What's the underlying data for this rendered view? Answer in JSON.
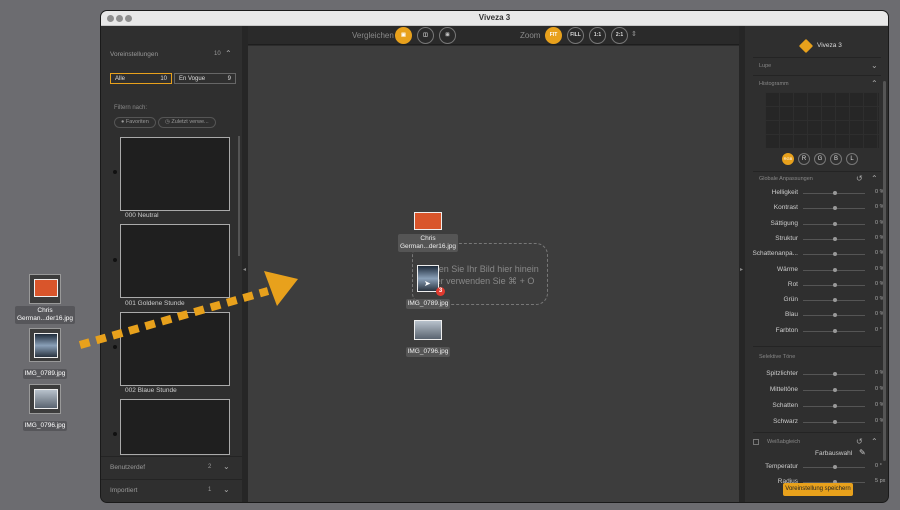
{
  "desktop": {
    "files": [
      {
        "label_line1": "Chris",
        "label_line2": "German...der16.jpg"
      },
      {
        "label_line1": "IMG_0789.jpg"
      },
      {
        "label_line1": "IMG_0796.jpg"
      }
    ]
  },
  "window": {
    "title": "Viveza 3"
  },
  "toolbar": {
    "compare_label": "Vergleichen",
    "zoom_label": "Zoom",
    "zoom_buttons": [
      "FIT",
      "FILL",
      "1:1",
      "2:1"
    ]
  },
  "left_panel": {
    "presets_title": "Voreinstellungen",
    "presets_count": "10",
    "tabs": [
      {
        "label": "Alle",
        "count": "10"
      },
      {
        "label": "En Vogue",
        "count": "9"
      }
    ],
    "filter_label": "Filtern nach:",
    "filters": [
      "Favoriten",
      "Zuletzt verwe..."
    ],
    "presets": [
      "000 Neutral",
      "001 Goldene Stunde",
      "002 Blaue Stunde"
    ],
    "sections": [
      {
        "label": "Benutzerdef",
        "count": "2"
      },
      {
        "label": "Importiert",
        "count": "1"
      }
    ]
  },
  "center": {
    "dropzone_text": "Ziehen Sie Ihr Bild hier hinein oder verwenden Sie ⌘ + O",
    "dragged": [
      {
        "label_line1": "Chris",
        "label_line2": "German...der16.jpg"
      },
      {
        "label_line1": "IMG_0789.jpg",
        "badge": "3"
      },
      {
        "label_line1": "IMG_0796.jpg"
      }
    ]
  },
  "right_panel": {
    "brand": "Viveza 3",
    "loupe": "Lupe",
    "histogram": "Histogramm",
    "channels": [
      "RGB",
      "R",
      "G",
      "B",
      "L"
    ],
    "global_title": "Globale Anpassungen",
    "global": [
      {
        "name": "Helligkeit",
        "value": "0 %"
      },
      {
        "name": "Kontrast",
        "value": "0 %"
      },
      {
        "name": "Sättigung",
        "value": "0 %"
      },
      {
        "name": "Struktur",
        "value": "0 %"
      },
      {
        "name": "Schattenanpa...",
        "value": "0 %"
      },
      {
        "name": "Wärme",
        "value": "0 %"
      },
      {
        "name": "Rot",
        "value": "0 %"
      },
      {
        "name": "Grün",
        "value": "0 %"
      },
      {
        "name": "Blau",
        "value": "0 %"
      },
      {
        "name": "Farbton",
        "value": "0 °"
      }
    ],
    "selective_title": "Selektive Töne",
    "selective": [
      {
        "name": "Spitzlichter",
        "value": "0 %"
      },
      {
        "name": "Mitteltöne",
        "value": "0 %"
      },
      {
        "name": "Schatten",
        "value": "0 %"
      },
      {
        "name": "Schwarz",
        "value": "0 %"
      }
    ],
    "wb_title": "Weißabgleich",
    "wb_picker": "Farbauswahl",
    "wb": [
      {
        "name": "Temperatur",
        "value": "0 °"
      },
      {
        "name": "Radius",
        "value": "5 px"
      }
    ],
    "save_button": "Voreinstellung speichern"
  },
  "colors": {
    "accent": "#e8a11c"
  }
}
